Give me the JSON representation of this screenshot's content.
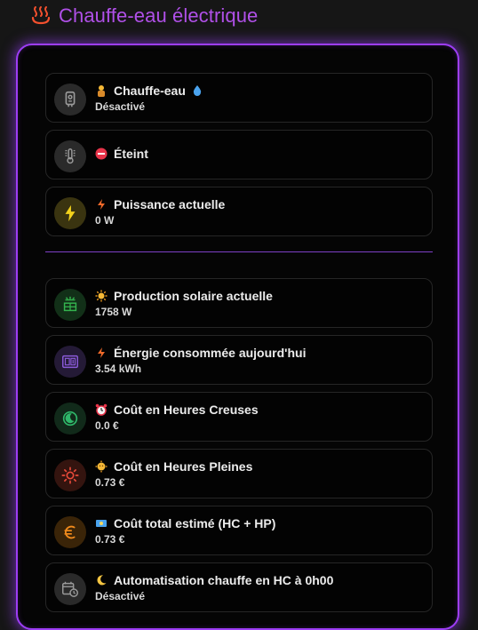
{
  "header": {
    "title": "Chauffe-eau électrique",
    "icon": "hot-springs-icon"
  },
  "entities": [
    {
      "name": "Chauffe-eau",
      "emoji_before": "plumber-emoji",
      "emoji_after": "droplet-emoji",
      "state": "Désactivé",
      "icon": "water-heater-icon"
    },
    {
      "name": "Éteint",
      "emoji_before": "no-entry-emoji",
      "state": "",
      "icon": "thermometer-icon"
    },
    {
      "name": "Puissance actuelle",
      "emoji_before": "lightning-emoji",
      "state": "0 W",
      "icon": "flash-icon"
    }
  ],
  "entities2": [
    {
      "name": "Production solaire actuelle",
      "emoji_before": "sun-emoji",
      "state": "1758 W",
      "icon": "solar-panel-icon"
    },
    {
      "name": "Énergie consommée aujourd'hui",
      "emoji_before": "lightning-emoji",
      "state": "3.54 kWh",
      "icon": "meter-icon"
    },
    {
      "name": "Coût en Heures Creuses",
      "emoji_before": "alarm-clock-emoji",
      "state": "0.0 €",
      "icon": "moon-icon"
    },
    {
      "name": "Coût en Heures Pleines",
      "emoji_before": "sun-face-emoji",
      "state": "0.73 €",
      "icon": "sun-icon"
    },
    {
      "name": "Coût total estimé (HC + HP)",
      "emoji_before": "money-emoji",
      "state": "0.73 €",
      "icon": "euro-icon"
    },
    {
      "name": "Automatisation chauffe en HC à 0h00",
      "emoji_before": "crescent-moon-emoji",
      "state": "Désactivé",
      "icon": "calendar-clock-icon"
    }
  ],
  "colors": {
    "accent": "#9d3df5",
    "title": "#b050e8",
    "flash": "#f2d21c",
    "solar": "#34b34e",
    "meter": "#8a5ad8",
    "moon": "#2fb86a",
    "sun": "#e84a3a",
    "euro": "#f08a1c"
  }
}
